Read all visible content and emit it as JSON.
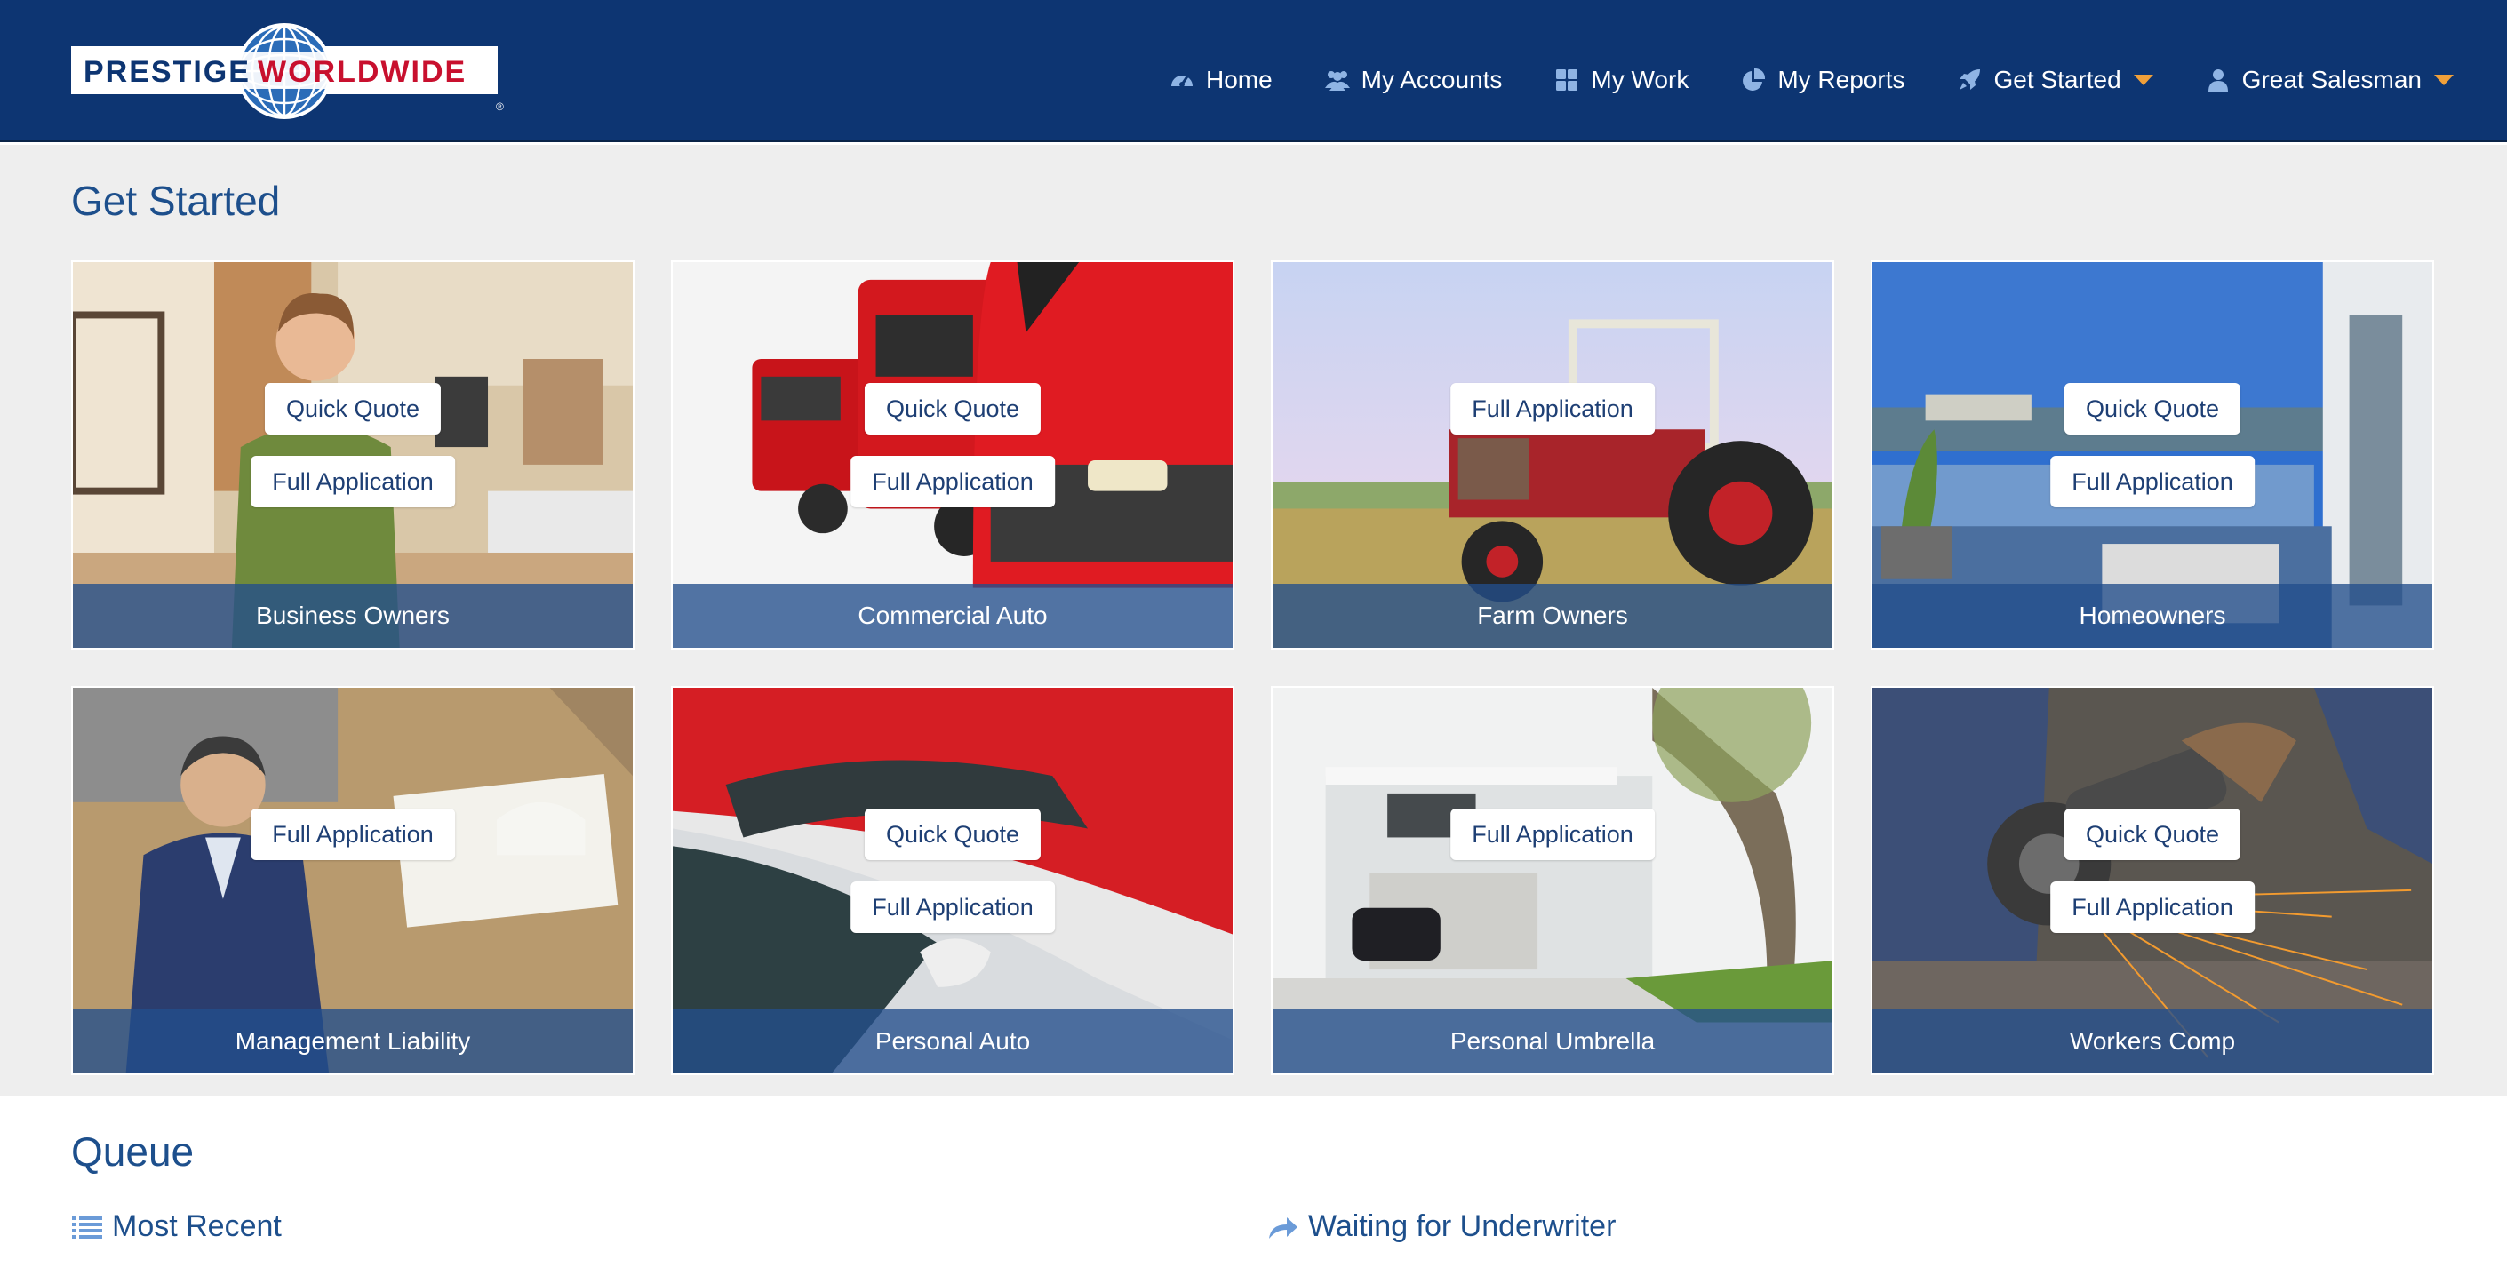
{
  "brand": {
    "word1": "PRESTIGE",
    "word2": "WORLDWIDE",
    "registered": "®"
  },
  "nav": [
    {
      "label": "Home",
      "icon": "dashboard-icon"
    },
    {
      "label": "My Accounts",
      "icon": "users-icon"
    },
    {
      "label": "My Work",
      "icon": "grid-icon"
    },
    {
      "label": "My Reports",
      "icon": "pie-chart-icon"
    },
    {
      "label": "Get Started",
      "icon": "rocket-icon",
      "dropdown": true
    },
    {
      "label": "Great Salesman",
      "icon": "user-icon",
      "dropdown": true
    }
  ],
  "get_started": {
    "title": "Get Started",
    "cards": [
      {
        "label": "Business Owners",
        "buttons": [
          "Quick Quote",
          "Full Application"
        ]
      },
      {
        "label": "Commercial Auto",
        "buttons": [
          "Quick Quote",
          "Full Application"
        ]
      },
      {
        "label": "Farm Owners",
        "buttons": [
          "Full Application"
        ]
      },
      {
        "label": "Homeowners",
        "buttons": [
          "Quick Quote",
          "Full Application"
        ]
      },
      {
        "label": "Management Liability",
        "buttons": [
          "Full Application"
        ]
      },
      {
        "label": "Personal Auto",
        "buttons": [
          "Quick Quote",
          "Full Application"
        ]
      },
      {
        "label": "Personal Umbrella",
        "buttons": [
          "Full Application"
        ]
      },
      {
        "label": "Workers Comp",
        "buttons": [
          "Quick Quote",
          "Full Application"
        ]
      }
    ]
  },
  "queue": {
    "title": "Queue",
    "tabs": [
      {
        "label": "Most Recent",
        "icon": "list-icon"
      },
      {
        "label": "Waiting for Underwriter",
        "icon": "share-arrow-icon"
      }
    ]
  },
  "colors": {
    "header": "#0d3572",
    "accent": "#f0a03a",
    "title": "#1d4f8c",
    "logo_red": "#c8102e"
  }
}
